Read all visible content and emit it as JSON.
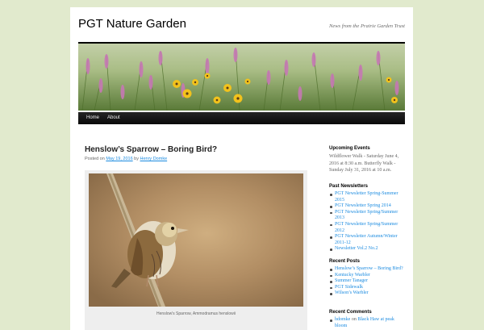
{
  "site": {
    "title": "PGT Nature Garden",
    "description": "News from the Prairie Garden Trust"
  },
  "nav": [
    {
      "label": "Home"
    },
    {
      "label": "About"
    }
  ],
  "post": {
    "title": "Henslow’s Sparrow – Boring Bird?",
    "meta": {
      "posted_on": "Posted on",
      "date": "May 19, 2016",
      "by": "by",
      "author": "Henry Domke"
    },
    "caption": "Henslow's Sparrow, Ammodramus henslowii"
  },
  "sidebar": {
    "upcoming": {
      "title": "Upcoming Events",
      "text": "Wildflower Walk - Saturday June 4, 2016 at 8:30 a.m. Butterfly Walk - Sunday July 31, 2016 at 10 a.m."
    },
    "newsletters": {
      "title": "Past Newsletters",
      "items": [
        "PGT Newsletter Spring-Summer 2015",
        "PGT Newsletter Spring 2014",
        "PGT Newsletter Spring/Summer 2013",
        "PGT Newsletter Spring/Summer 2012",
        "PGT Newsletter Autumn/Winter 2011-12",
        "Newsletter Vol.2 No.2"
      ]
    },
    "recent_posts": {
      "title": "Recent Posts",
      "items": [
        "Henslow’s Sparrow – Boring Bird?",
        "Kentucky Warbler",
        "Summer Tanager",
        "PGT Sidewalk",
        "Wilson’s Warbler"
      ]
    },
    "recent_comments": {
      "title": "Recent Comments",
      "items": [
        {
          "author": "hdomke",
          "on": "on",
          "link": "Black Haw at peak bloom"
        }
      ]
    }
  },
  "colors": {
    "page_bg": "#e1eacd",
    "link": "#1b8be0",
    "nav_bg": "#111111"
  },
  "icons": {
    "header_image": "prairie-flowers-photo",
    "post_image": "sparrow-photo"
  }
}
